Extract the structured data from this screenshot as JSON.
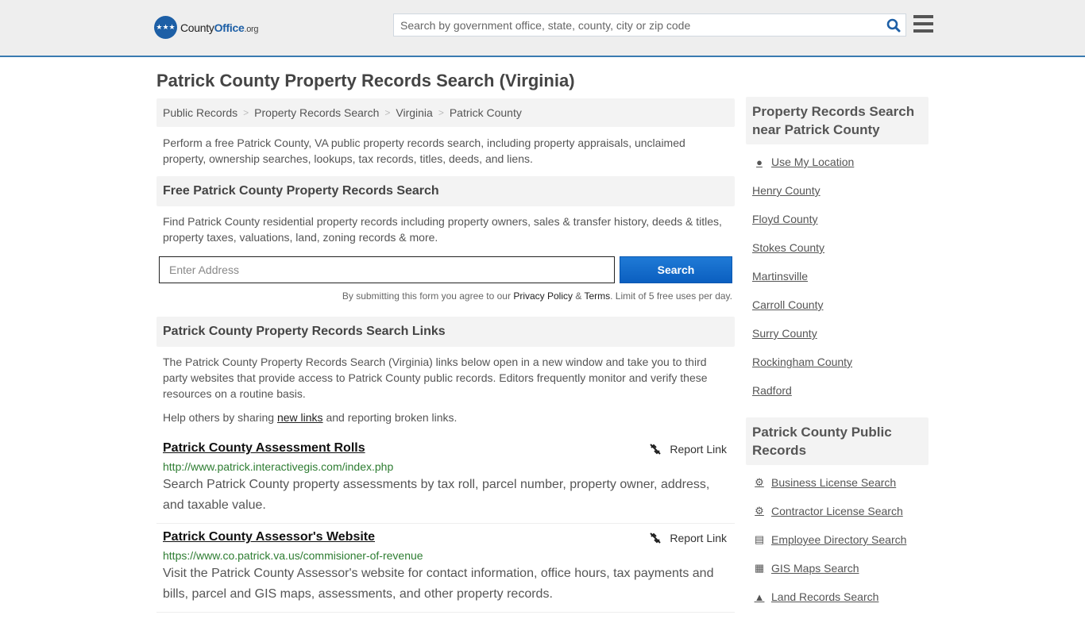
{
  "header": {
    "logo": {
      "county": "County",
      "office": "Office",
      "tld": ".org"
    },
    "search_placeholder": "Search by government office, state, county, city or zip code"
  },
  "page_title": "Patrick County Property Records Search (Virginia)",
  "breadcrumb": [
    "Public Records",
    "Property Records Search",
    "Virginia",
    "Patrick County"
  ],
  "intro": "Perform a free Patrick County, VA public property records search, including property appraisals, unclaimed property, ownership searches, lookups, tax records, titles, deeds, and liens.",
  "free_search": {
    "heading": "Free Patrick County Property Records Search",
    "description": "Find Patrick County residential property records including property owners, sales & transfer history, deeds & titles, property taxes, valuations, land, zoning records & more.",
    "address_placeholder": "Enter Address",
    "button_label": "Search",
    "terms_prefix": "By submitting this form you agree to our ",
    "privacy_label": "Privacy Policy",
    "amp": " & ",
    "terms_label": "Terms",
    "terms_suffix": ". Limit of 5 free uses per day."
  },
  "links_section": {
    "heading": "Patrick County Property Records Search Links",
    "description": "The Patrick County Property Records Search (Virginia) links below open in a new window and take you to third party websites that provide access to Patrick County public records. Editors frequently monitor and verify these resources on a routine basis.",
    "help_prefix": "Help others by sharing ",
    "help_link": "new links",
    "help_suffix": " and reporting broken links.",
    "report_label": "Report Link",
    "items": [
      {
        "title": "Patrick County Assessment Rolls",
        "url": "http://www.patrick.interactivegis.com/index.php",
        "description": "Search Patrick County property assessments by tax roll, parcel number, property owner, address, and taxable value."
      },
      {
        "title": "Patrick County Assessor's Website",
        "url": "https://www.co.patrick.va.us/commisioner-of-revenue",
        "description": "Visit the Patrick County Assessor's website for contact information, office hours, tax payments and bills, parcel and GIS maps, assessments, and other property records."
      }
    ]
  },
  "sidebar": {
    "nearby_heading": "Property Records Search near Patrick County",
    "use_location": "Use My Location",
    "nearby": [
      "Henry County",
      "Floyd County",
      "Stokes County",
      "Martinsville",
      "Carroll County",
      "Surry County",
      "Rockingham County",
      "Radford"
    ],
    "public_heading": "Patrick County Public Records",
    "public_records": [
      {
        "label": "Business License Search",
        "icon": "gears-icon"
      },
      {
        "label": "Contractor License Search",
        "icon": "gear-icon"
      },
      {
        "label": "Employee Directory Search",
        "icon": "book-icon"
      },
      {
        "label": "GIS Maps Search",
        "icon": "map-icon"
      },
      {
        "label": "Land Records Search",
        "icon": "tree-icon"
      }
    ]
  }
}
